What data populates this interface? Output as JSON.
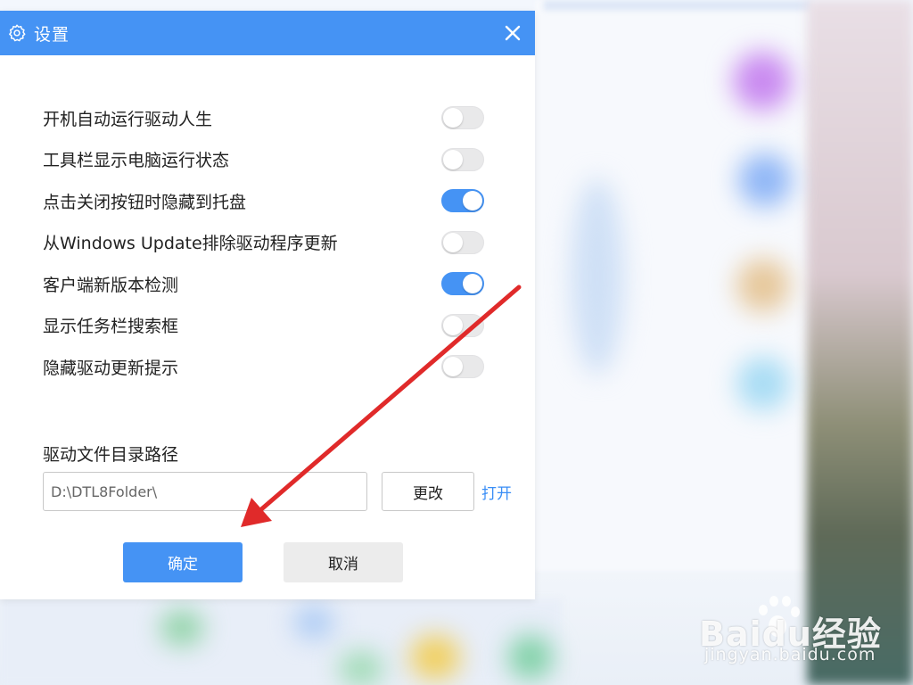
{
  "dialog": {
    "title": "设置",
    "title_icon": "gear-icon",
    "close_icon": "close-icon"
  },
  "options": [
    {
      "label": "开机自动运行驱动人生",
      "on": false
    },
    {
      "label": "工具栏显示电脑运行状态",
      "on": false
    },
    {
      "label": "点击关闭按钮时隐藏到托盘",
      "on": true
    },
    {
      "label": "从Windows Update排除驱动程序更新",
      "on": false
    },
    {
      "label": "客户端新版本检测",
      "on": true
    },
    {
      "label": "显示任务栏搜索框",
      "on": false
    },
    {
      "label": "隐藏驱动更新提示",
      "on": false
    }
  ],
  "driver_path": {
    "label": "驱动文件目录路径",
    "value": "D:\\DTL8Folder\\",
    "change_label": "更改",
    "open_label": "打开"
  },
  "footer": {
    "ok_label": "确定",
    "cancel_label": "取消"
  },
  "watermark": {
    "brand": "Baidu经验",
    "url": "jingyan.baidu.com"
  },
  "colors": {
    "accent": "#4593f4",
    "toggle_off": "#e9e9ea",
    "link": "#3a8ef6",
    "annotation_arrow": "#e02a2a"
  }
}
